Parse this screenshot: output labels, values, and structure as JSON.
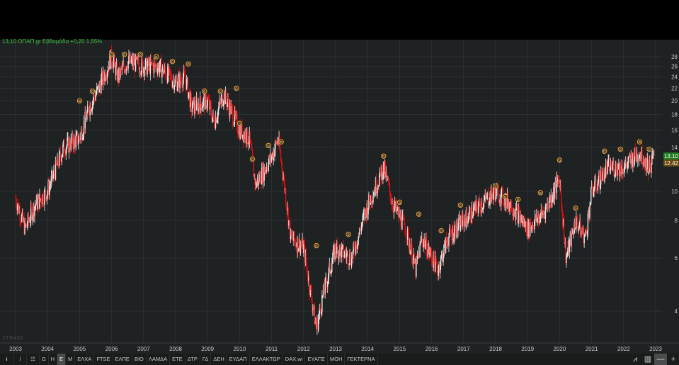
{
  "header": {
    "quote_line": "13,10 ΟΠΑΠ.gr Εβδομάδα +0,20 1,55%"
  },
  "watermark": "ZTRADE",
  "colors": {
    "up": "#e8e8e8",
    "down": "#e01010",
    "last_price": "#1e7a1e",
    "prev_price": "#6a4a10",
    "dividend": "#f0a030"
  },
  "toolbar": {
    "info": "i",
    "draw": "/",
    "grid": "☷",
    "items": [
      "Ω",
      "Η",
      "Ε",
      "Μ",
      "ΕΛΧΑ",
      "FTSE",
      "ΕΛΠΕ",
      "ΒΙΟ",
      "ΛΑΜΔΑ",
      "ΕΤΕ",
      "ΔΤΡ",
      "ΓΔ",
      "ΔΕΗ",
      "ΕΥΔΑΠ",
      "ΕΛΛΑΚΤΩΡ",
      "DAX.wi",
      "ΕΥΑΠΣ",
      "ΜΟΗ",
      "ΓΕΚΤΕΡΝΑ"
    ],
    "selected": "Ε",
    "minus": "—",
    "plus": "+"
  },
  "chart_data": {
    "type": "candlestick",
    "scale": "log",
    "x_ticks": [
      "2003",
      "2004",
      "2005",
      "2006",
      "2007",
      "2008",
      "2009",
      "2010",
      "2011",
      "2012",
      "2013",
      "2014",
      "2015",
      "2016",
      "2017",
      "2018",
      "2019",
      "2020",
      "2021",
      "2022",
      "2023"
    ],
    "y_ticks": [
      4,
      6,
      8,
      10,
      14,
      16,
      18,
      20,
      22,
      24,
      26,
      28
    ],
    "ylim": [
      3.3,
      31
    ],
    "last_price": "13.10",
    "prev_price": "12.42",
    "path": [
      [
        2003.0,
        9.5
      ],
      [
        2003.3,
        7.5
      ],
      [
        2003.6,
        9
      ],
      [
        2004.0,
        10
      ],
      [
        2004.5,
        14
      ],
      [
        2005.0,
        15
      ],
      [
        2005.3,
        19
      ],
      [
        2005.6,
        22
      ],
      [
        2006.0,
        28
      ],
      [
        2006.2,
        24
      ],
      [
        2006.5,
        27
      ],
      [
        2007.0,
        26
      ],
      [
        2007.5,
        26
      ],
      [
        2008.0,
        23
      ],
      [
        2008.3,
        24
      ],
      [
        2008.5,
        19
      ],
      [
        2009.0,
        20
      ],
      [
        2009.2,
        17
      ],
      [
        2009.5,
        21
      ],
      [
        2010.0,
        16
      ],
      [
        2010.3,
        15
      ],
      [
        2010.5,
        10.5
      ],
      [
        2011.0,
        13
      ],
      [
        2011.2,
        15
      ],
      [
        2011.4,
        10.5
      ],
      [
        2011.6,
        7
      ],
      [
        2012.0,
        6.5
      ],
      [
        2012.4,
        3.5
      ],
      [
        2012.6,
        4.5
      ],
      [
        2013.0,
        6.5
      ],
      [
        2013.5,
        6
      ],
      [
        2014.0,
        9
      ],
      [
        2014.5,
        12
      ],
      [
        2014.8,
        9
      ],
      [
        2015.2,
        7.5
      ],
      [
        2015.5,
        5.5
      ],
      [
        2015.7,
        7
      ],
      [
        2016.2,
        5.5
      ],
      [
        2016.5,
        7
      ],
      [
        2017.0,
        8
      ],
      [
        2017.5,
        9
      ],
      [
        2018.0,
        10
      ],
      [
        2018.5,
        9
      ],
      [
        2019.0,
        7.5
      ],
      [
        2019.5,
        8.5
      ],
      [
        2020.0,
        11
      ],
      [
        2020.2,
        6
      ],
      [
        2020.5,
        8
      ],
      [
        2020.8,
        7
      ],
      [
        2021.0,
        10
      ],
      [
        2021.5,
        12
      ],
      [
        2022.0,
        12
      ],
      [
        2022.5,
        13.5
      ],
      [
        2022.8,
        12
      ],
      [
        2022.95,
        13.1
      ]
    ],
    "dividend_marker": "D",
    "dividends": [
      [
        2005.0,
        20
      ],
      [
        2005.4,
        21.5
      ],
      [
        2006.0,
        28.5
      ],
      [
        2006.4,
        28.5
      ],
      [
        2006.9,
        28.5
      ],
      [
        2007.4,
        28
      ],
      [
        2007.9,
        27
      ],
      [
        2008.4,
        26.5
      ],
      [
        2008.9,
        21.5
      ],
      [
        2009.4,
        21.5
      ],
      [
        2009.9,
        22
      ],
      [
        2010.0,
        16.8
      ],
      [
        2010.4,
        12.8
      ],
      [
        2010.9,
        14.2
      ],
      [
        2011.3,
        14.6
      ],
      [
        2012.4,
        6.6
      ],
      [
        2013.4,
        7.2
      ],
      [
        2014.5,
        13.1
      ],
      [
        2015.0,
        9.2
      ],
      [
        2015.6,
        8.4
      ],
      [
        2016.3,
        7.4
      ],
      [
        2016.9,
        9.0
      ],
      [
        2018.0,
        10.4
      ],
      [
        2018.3,
        9.6
      ],
      [
        2018.7,
        9.4
      ],
      [
        2019.4,
        9.9
      ],
      [
        2020.0,
        12.7
      ],
      [
        2020.5,
        8.8
      ],
      [
        2021.4,
        13.6
      ],
      [
        2021.9,
        13.8
      ],
      [
        2022.5,
        14.6
      ],
      [
        2022.8,
        13.8
      ]
    ]
  }
}
